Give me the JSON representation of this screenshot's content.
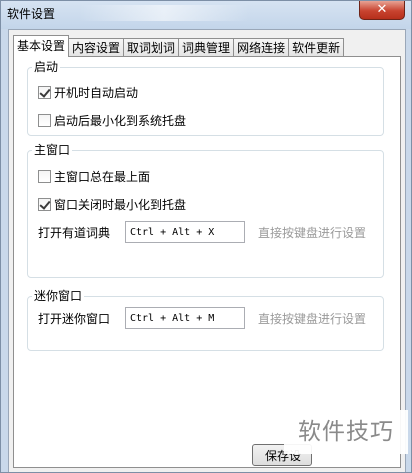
{
  "window": {
    "title": "软件设置",
    "close_glyph": "✕"
  },
  "tabs": [
    {
      "label": "基本设置",
      "active": true
    },
    {
      "label": "内容设置",
      "active": false
    },
    {
      "label": "取词划词",
      "active": false
    },
    {
      "label": "词典管理",
      "active": false
    },
    {
      "label": "网络连接",
      "active": false
    },
    {
      "label": "软件更新",
      "active": false
    }
  ],
  "startup": {
    "title": "启动",
    "auto_start_label": "开机时自动启动",
    "auto_start_checked": true,
    "minimize_to_tray_label": "启动后最小化到系统托盘",
    "minimize_to_tray_checked": false
  },
  "main_window": {
    "title": "主窗口",
    "always_on_top_label": "主窗口总在最上面",
    "always_on_top_checked": false,
    "close_to_tray_label": "窗口关闭时最小化到托盘",
    "close_to_tray_checked": true,
    "hotkey_label": "打开有道词典",
    "hotkey_value": "Ctrl + Alt + X",
    "hotkey_hint": "直接按键盘进行设置"
  },
  "mini_window": {
    "title": "迷你窗口",
    "hotkey_label": "打开迷你窗口",
    "hotkey_value": "Ctrl + Alt + M",
    "hotkey_hint": "直接按键盘进行设置"
  },
  "footer": {
    "save_label": "保存设"
  },
  "watermark": {
    "text": "软件技巧"
  },
  "icons": {
    "checkbox_checked": "checkmark-icon",
    "close": "close-icon"
  }
}
